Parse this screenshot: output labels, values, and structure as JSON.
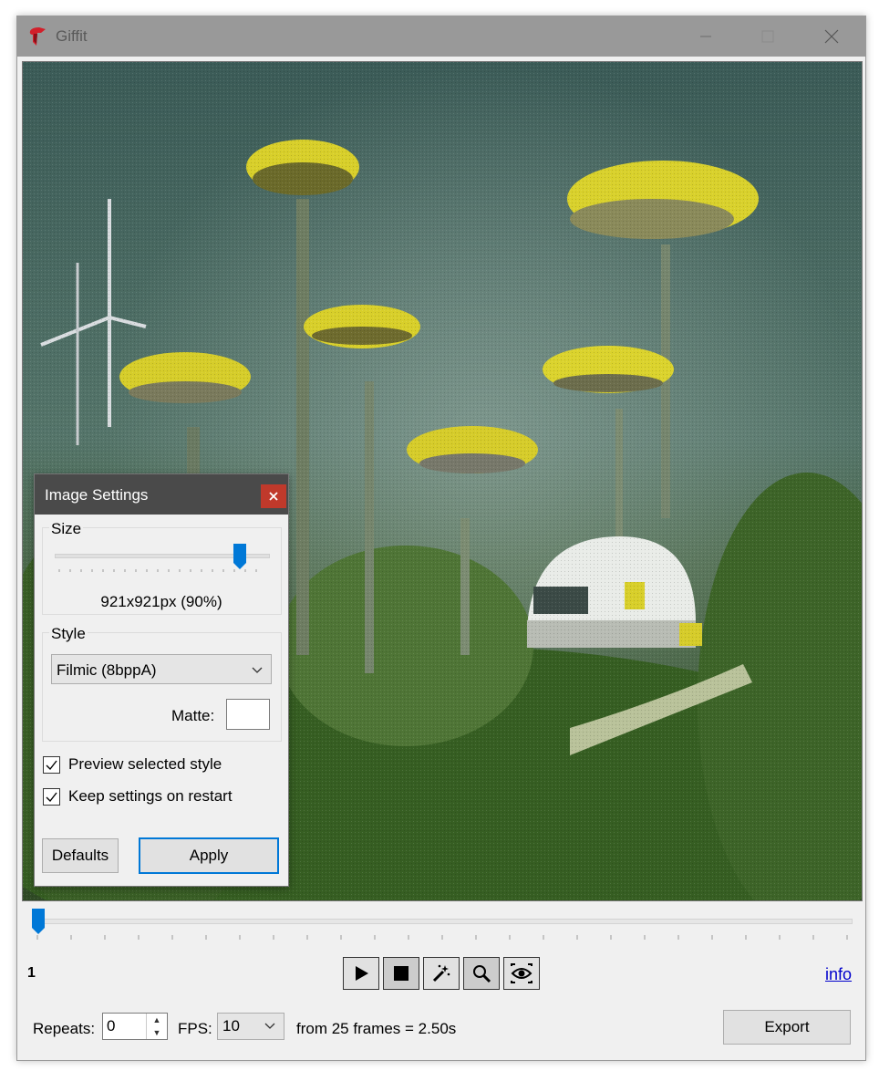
{
  "window": {
    "title": "Giffit",
    "minimize_icon": "minimize-icon",
    "maximize_icon": "maximize-icon",
    "close_icon": "close-icon"
  },
  "preview": {
    "image_description": "Dithered GIF frame"
  },
  "timeline": {
    "frame_number": "1",
    "position_fraction": 0.0
  },
  "toolbar": {
    "tools": [
      "play-icon",
      "stop-icon",
      "magic-wand-icon",
      "zoom-icon",
      "eye-icon"
    ]
  },
  "info_link": "info",
  "bottom": {
    "repeats_label": "Repeats:",
    "repeats_value": "0",
    "fps_label": "FPS:",
    "fps_value": "10",
    "frames_text": "from 25 frames = 2.50s",
    "export_label": "Export"
  },
  "dialog": {
    "title": "Image Settings",
    "size_group": "Size",
    "size_value": "921x921px (90%)",
    "size_fraction": 0.9,
    "style_group": "Style",
    "style_value": "Filmic (8bppA)",
    "matte_label": "Matte:",
    "preview_style_label": "Preview selected style",
    "keep_settings_label": "Keep settings on restart",
    "preview_style_checked": true,
    "keep_settings_checked": true,
    "defaults_label": "Defaults",
    "apply_label": "Apply"
  },
  "colors": {
    "accent": "#0078d7",
    "close_red": "#c0392b",
    "title_bar": "#999999",
    "dialog_title": "#4a4a4a",
    "link": "#0000cc"
  }
}
